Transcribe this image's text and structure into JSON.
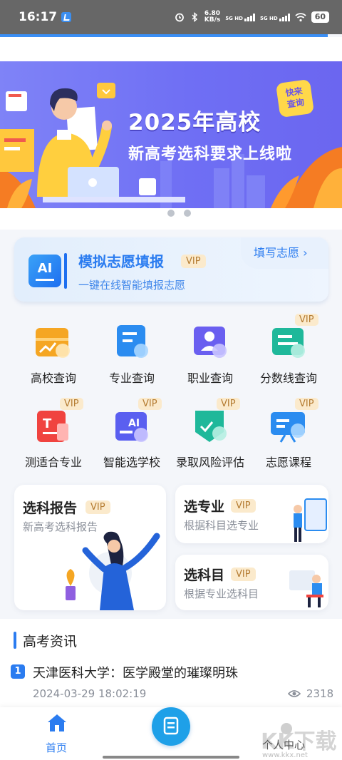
{
  "status_bar": {
    "time": "16:17",
    "speed_value": "6.80",
    "speed_unit": "KB/s",
    "net1": "5G HD",
    "net2": "5G HD",
    "battery": "60"
  },
  "banner": {
    "title": "2025年高校",
    "subtitle": "新高考选科要求上线啦",
    "badge_line1": "快来",
    "badge_line2": "查询",
    "page_count": 2,
    "active_page": 1
  },
  "ai_card": {
    "logo_text": "AI",
    "title": "模拟志愿填报",
    "vip": "VIP",
    "description": "一键在线智能填报志愿",
    "link": "填写志愿 ›"
  },
  "grid": [
    {
      "label": "高校查询",
      "vip": "",
      "icon": "university-search-icon",
      "color": "#f5a623"
    },
    {
      "label": "专业查询",
      "vip": "",
      "icon": "major-search-icon",
      "color": "#2b8cf0"
    },
    {
      "label": "职业查询",
      "vip": "",
      "icon": "career-search-icon",
      "color": "#6a5ff0"
    },
    {
      "label": "分数线查询",
      "vip": "VIP",
      "icon": "score-line-icon",
      "color": "#1fb89a"
    },
    {
      "label": "测适合专业",
      "vip": "VIP",
      "icon": "major-test-icon",
      "color": "#f0433f"
    },
    {
      "label": "智能选学校",
      "vip": "VIP",
      "icon": "ai-school-icon",
      "color": "#5a5ff0"
    },
    {
      "label": "录取风险评估",
      "vip": "VIP",
      "icon": "risk-assessment-icon",
      "color": "#1fb89a"
    },
    {
      "label": "志愿课程",
      "vip": "VIP",
      "icon": "course-icon",
      "color": "#2b8cf0"
    }
  ],
  "cards": {
    "report": {
      "title": "选科报告",
      "vip": "VIP",
      "desc": "新高考选科报告"
    },
    "major": {
      "title": "选专业",
      "vip": "VIP",
      "desc": "根据科目选专业"
    },
    "subject": {
      "title": "选科目",
      "vip": "VIP",
      "desc": "根据专业选科目"
    }
  },
  "news": {
    "section_title": "高考资讯",
    "items": [
      {
        "index": "1",
        "title": "天津医科大学：医学殿堂的璀璨明珠",
        "date": "2024-03-29 18:02:19",
        "views": "2318"
      }
    ]
  },
  "bottom_nav": {
    "home": "首页",
    "me": "个人中心"
  },
  "watermark": {
    "text": "www.kkx.net"
  }
}
